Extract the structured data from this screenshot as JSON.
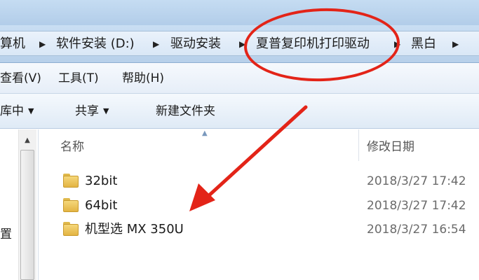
{
  "breadcrumb": {
    "items": [
      "算机",
      "软件安装 (D:)",
      "驱动安装",
      "夏普复印机打印驱动",
      "黑白"
    ]
  },
  "menu": {
    "items": [
      "查看(V)",
      "工具(T)",
      "帮助(H)"
    ]
  },
  "toolbar": {
    "library_label": "库中",
    "share_label": "共享",
    "new_folder_label": "新建文件夹"
  },
  "nav": {
    "partial_item": "置"
  },
  "list": {
    "columns": [
      "名称",
      "修改日期"
    ],
    "rows": [
      {
        "name": "32bit",
        "modified": "2018/3/27 17:42"
      },
      {
        "name": "64bit",
        "modified": "2018/3/27 17:42"
      },
      {
        "name": "机型选 MX 350U",
        "modified": "2018/3/27 16:54"
      }
    ]
  },
  "annotation": {
    "color": "#e32418"
  },
  "icons": {
    "breadcrumb_separator": "chevron-right-icon",
    "dropdown": "caret-down-icon",
    "folder": "folder-icon",
    "sort": "sort-ascending-icon"
  }
}
